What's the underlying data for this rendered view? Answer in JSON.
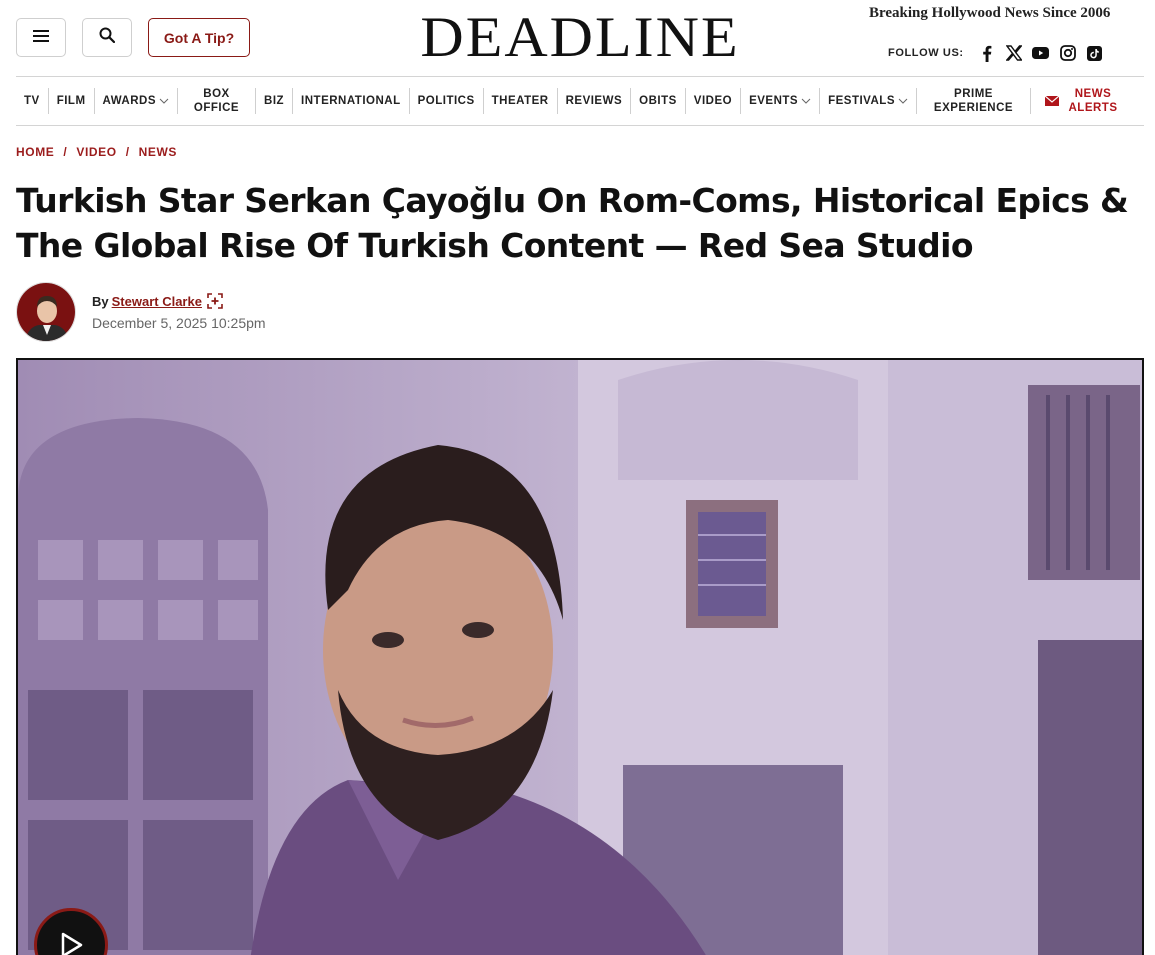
{
  "header": {
    "tip_label": "Got A Tip?",
    "logo": "DEADLINE",
    "tagline": "Breaking Hollywood News Since 2006",
    "follow_label": "FOLLOW US:",
    "social_icons": [
      "facebook-icon",
      "x-icon",
      "youtube-icon",
      "instagram-icon",
      "tiktok-icon"
    ]
  },
  "nav": {
    "items": [
      {
        "label": "TV"
      },
      {
        "label": "FILM"
      },
      {
        "label": "AWARDS",
        "dropdown": true
      },
      {
        "label": "BOX OFFICE"
      },
      {
        "label": "BIZ"
      },
      {
        "label": "INTERNATIONAL"
      },
      {
        "label": "POLITICS"
      },
      {
        "label": "THEATER"
      },
      {
        "label": "REVIEWS"
      },
      {
        "label": "OBITS"
      },
      {
        "label": "VIDEO"
      },
      {
        "label": "EVENTS",
        "dropdown": true
      },
      {
        "label": "FESTIVALS",
        "dropdown": true
      },
      {
        "label": "PRIME EXPERIENCE"
      },
      {
        "label": "NEWS ALERTS"
      }
    ]
  },
  "breadcrumb": [
    "HOME",
    "VIDEO",
    "NEWS"
  ],
  "article": {
    "title": "Turkish Star Serkan Çayoğlu On Rom-Coms, Historical Epics & The Global Rise Of Turkish Content — Red Sea Studio",
    "by": "By",
    "author": "Stewart Clarke",
    "date": "December 5, 2025 10:25pm"
  },
  "colors": {
    "accent": "#8a1a16",
    "breadcrumb": "#9b1c1c",
    "hero_tint": "#b9a9c9"
  }
}
